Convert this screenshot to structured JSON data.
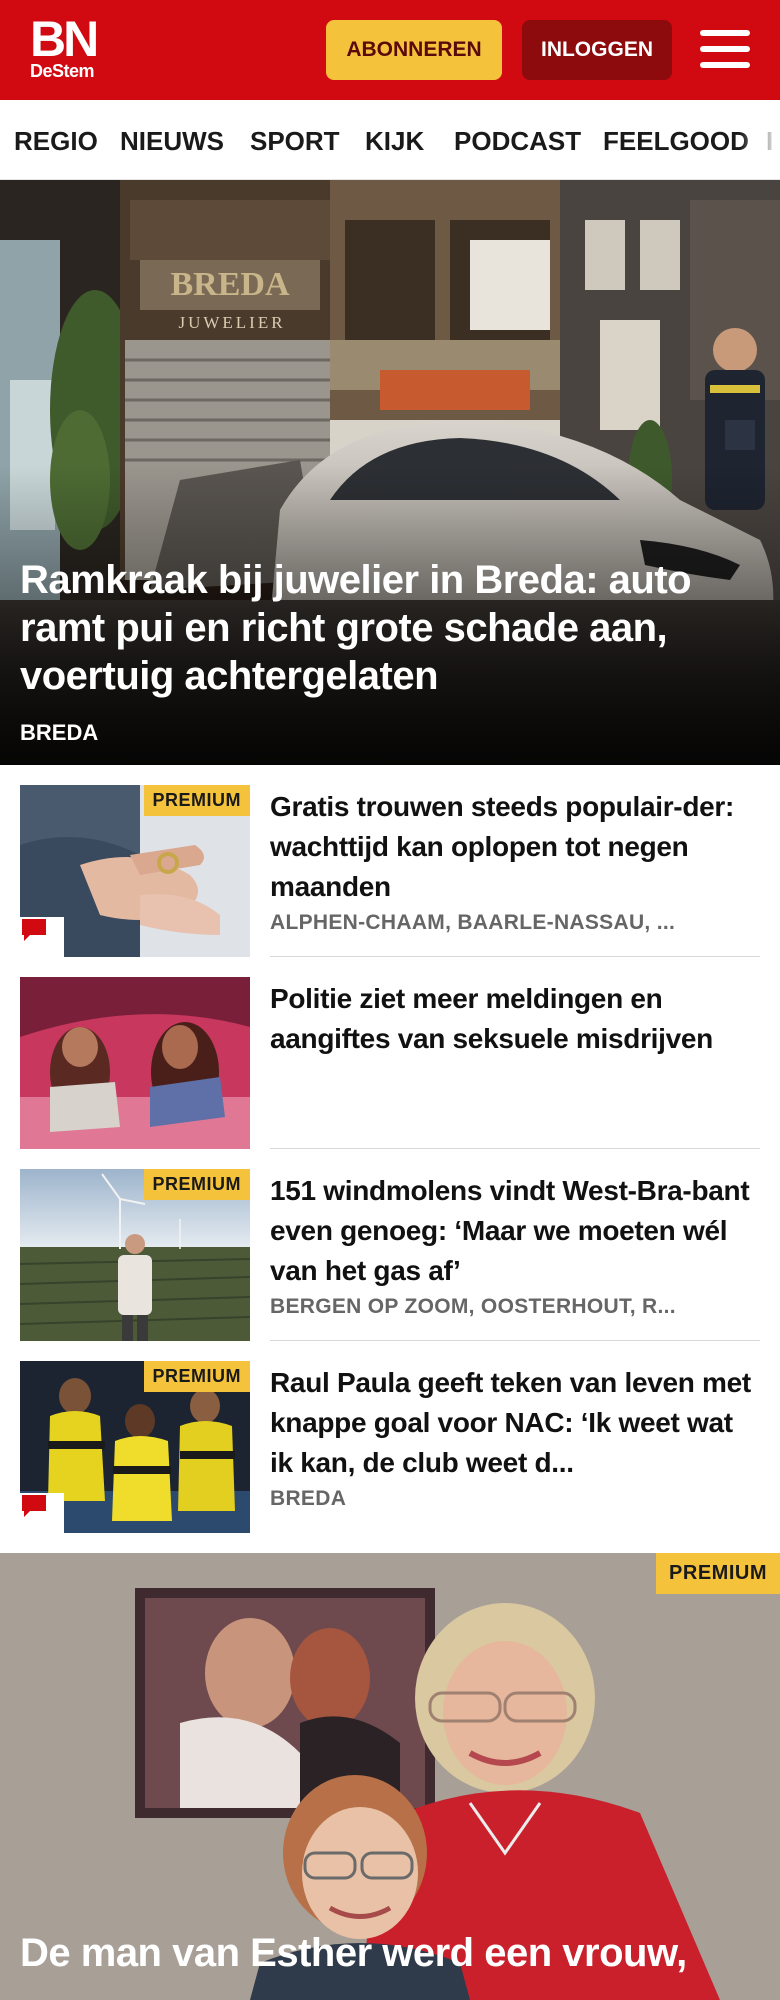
{
  "header": {
    "logo_main": "BN",
    "logo_sub": "DeStem",
    "subscribe_label": "ABONNEREN",
    "login_label": "INLOGGEN",
    "brand_color": "#d10a11",
    "menu_icon": "hamburger-icon"
  },
  "nav": {
    "items": [
      "REGIO",
      "NIEUWS",
      "SPORT",
      "KIJK",
      "PODCAST",
      "FEELGOOD",
      "I"
    ]
  },
  "hero": {
    "title": "Ramkraak bij juwelier in Breda: auto ramt pui en richt grote schade aan, voertuig achtergelaten",
    "location": "BREDA",
    "sign_name": "BREDA",
    "sign_sub": "JUWELIER"
  },
  "articles": [
    {
      "title": "Gratis trouwen steeds populair-der: wachttijd kan oplopen tot negen maanden",
      "location": "ALPHEN-CHAAM, BAARLE-NASSAU, ...",
      "premium": "PREMIUM",
      "has_comments": true
    },
    {
      "title": "Politie ziet meer meldingen en aangiftes van seksuele misdrijven",
      "location": "",
      "premium": "",
      "has_comments": false
    },
    {
      "title": "151 windmolens vindt West-Bra-bant even genoeg: ‘Maar we moeten wél van het gas af’",
      "location": "BERGEN OP ZOOM, OOSTERHOUT, R...",
      "premium": "PREMIUM",
      "has_comments": false
    },
    {
      "title": "Raul Paula geeft teken van leven met knappe goal voor NAC: ‘Ik weet wat ik kan, de club weet d...",
      "location": "BREDA",
      "premium": "PREMIUM",
      "has_comments": true
    }
  ],
  "feature": {
    "premium": "PREMIUM",
    "title": "De man van Esther werd een vrouw,"
  },
  "colors": {
    "premium_badge": "#f5c33b",
    "login_button": "#8d0a0d",
    "comment_icon": "#d10a11"
  }
}
